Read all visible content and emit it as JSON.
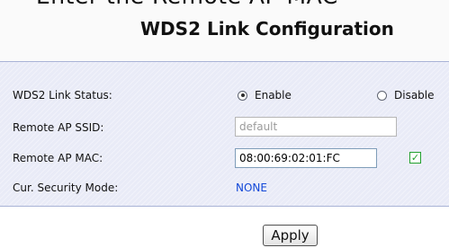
{
  "header": {
    "cut_text": "Enter the Remote AP MAC",
    "title": "WDS2 Link Configuration"
  },
  "form": {
    "link_status_label": "WDS2 Link Status:",
    "enable_label": "Enable",
    "disable_label": "Disable",
    "selected_status": "Enable",
    "remote_ssid_label": "Remote AP SSID:",
    "remote_ssid_value": "default",
    "remote_mac_label": "Remote AP MAC:",
    "remote_mac_value": "08:00:69:02:01:FC",
    "mac_checkbox_checked": true,
    "security_mode_label": "Cur. Security Mode:",
    "security_mode_value": "NONE"
  },
  "actions": {
    "apply_label": "Apply"
  }
}
